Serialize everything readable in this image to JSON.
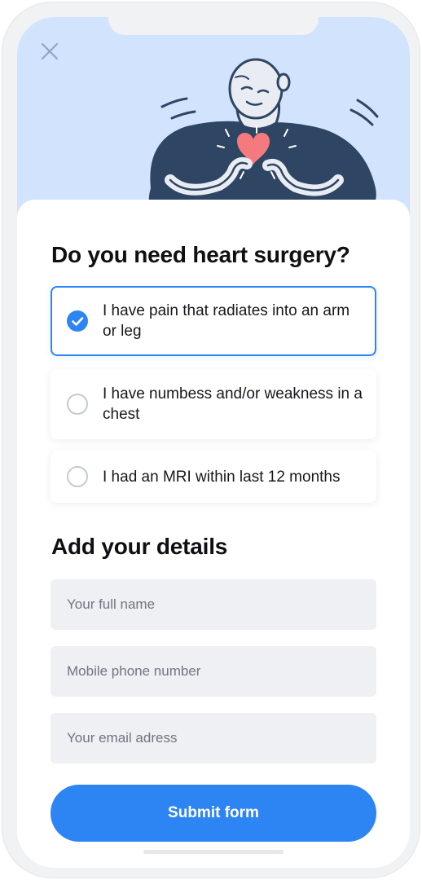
{
  "hero": {
    "close_icon": "close-icon",
    "illustration": "person-holding-heart-illustration",
    "colors": {
      "background": "#d2e3fd",
      "figure": "#2e4563",
      "heart": "#f47a7e"
    }
  },
  "question": {
    "title": "Do you need heart surgery?",
    "options": [
      {
        "label": "I have pain that radiates into an arm or leg",
        "selected": true
      },
      {
        "label": "I have numbess and/or weakness in a chest",
        "selected": false
      },
      {
        "label": "I had an MRI within last 12 months",
        "selected": false
      }
    ]
  },
  "details": {
    "title": "Add your details",
    "name_placeholder": "Your full name",
    "phone_placeholder": "Mobile phone number",
    "email_placeholder": "Your email adress"
  },
  "submit": {
    "label": "Submit form"
  },
  "colors": {
    "accent": "#2d85f3",
    "field_bg": "#eef0f3"
  }
}
